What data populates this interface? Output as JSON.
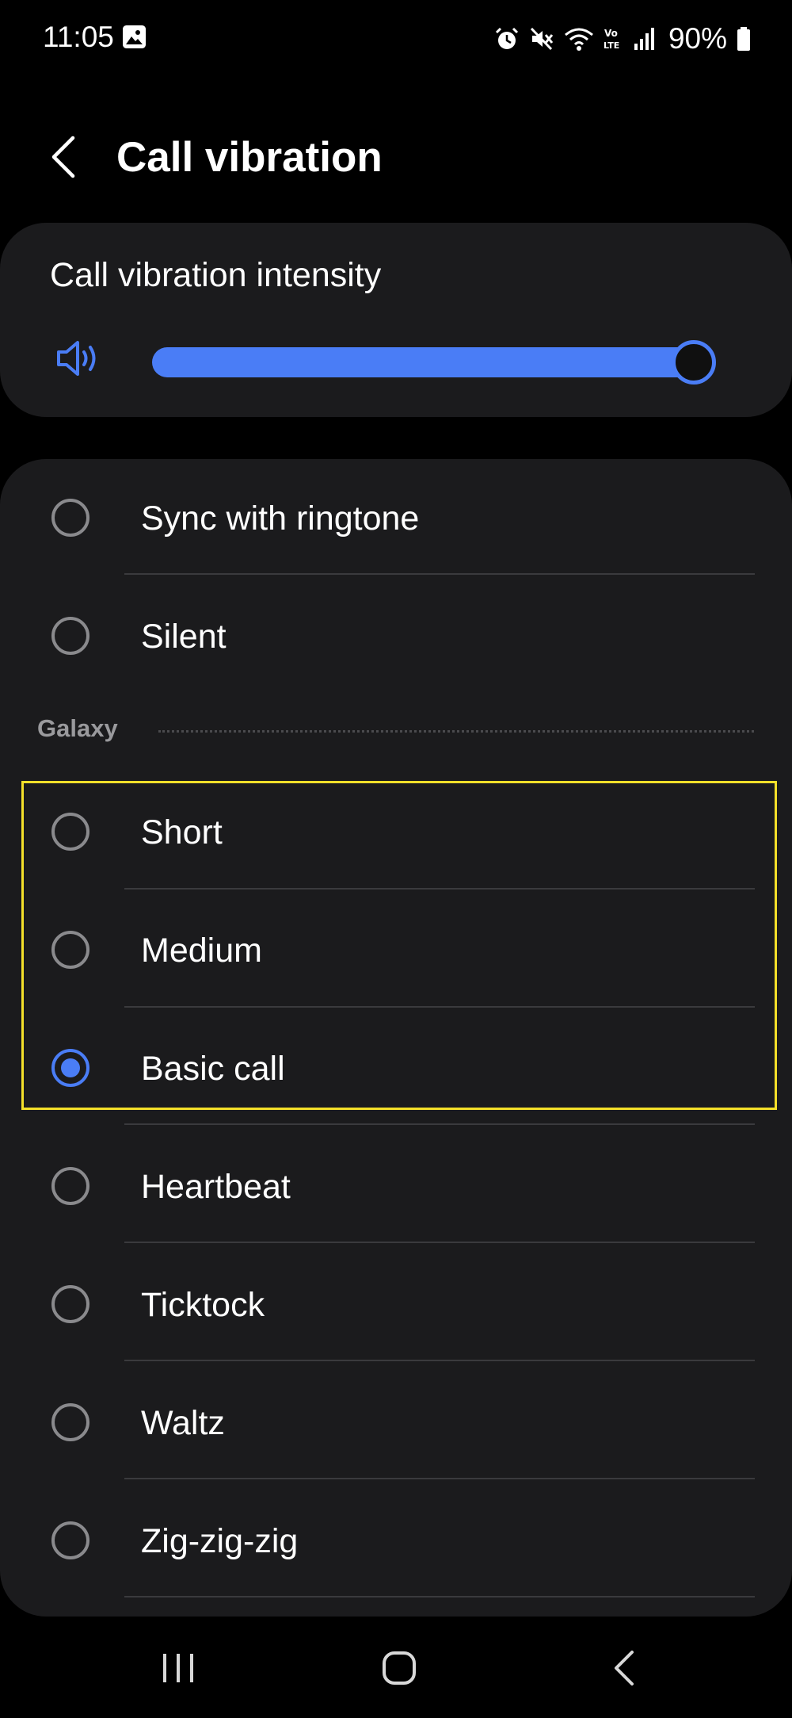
{
  "status_bar": {
    "time": "11:05",
    "battery": "90%",
    "icons": [
      "image-icon",
      "alarm-icon",
      "mute-icon",
      "wifi-icon",
      "volte-icon",
      "signal-icon",
      "battery-icon"
    ]
  },
  "header": {
    "title": "Call vibration",
    "back_icon": "chevron-left-icon"
  },
  "intensity": {
    "label": "Call vibration intensity",
    "icon": "speaker-icon",
    "level_percent": 100,
    "accent_color": "#4a7df6"
  },
  "options_top": [
    {
      "label": "Sync with ringtone",
      "selected": false
    },
    {
      "label": "Silent",
      "selected": false
    }
  ],
  "section": {
    "title": "Galaxy"
  },
  "options_galaxy": [
    {
      "label": "Short",
      "selected": false
    },
    {
      "label": "Medium",
      "selected": false
    },
    {
      "label": "Basic call",
      "selected": true
    },
    {
      "label": "Heartbeat",
      "selected": false
    },
    {
      "label": "Ticktock",
      "selected": false
    },
    {
      "label": "Waltz",
      "selected": false
    },
    {
      "label": "Zig-zig-zig",
      "selected": false
    }
  ],
  "highlight_color": "#f4e02a",
  "nav": {
    "recents_icon": "recents-icon",
    "home_icon": "home-icon",
    "back_icon": "back-icon"
  }
}
